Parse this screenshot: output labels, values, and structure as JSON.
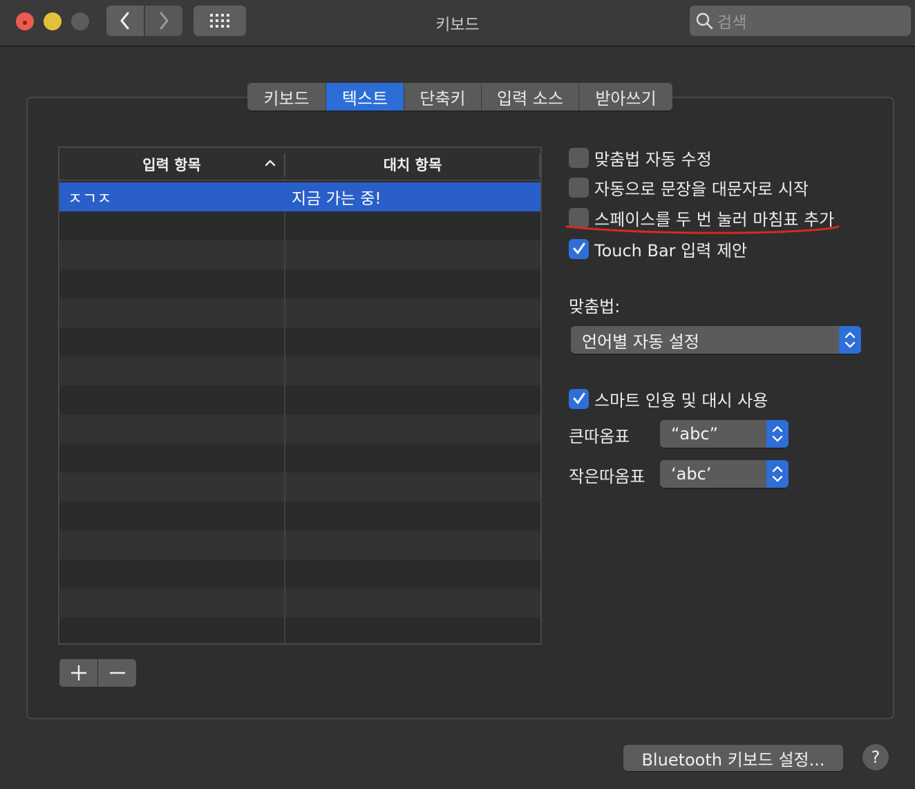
{
  "window": {
    "title": "키보드"
  },
  "search": {
    "placeholder": "검색"
  },
  "tabs": [
    {
      "label": "키보드",
      "active": false
    },
    {
      "label": "텍스트",
      "active": true
    },
    {
      "label": "단축키",
      "active": false
    },
    {
      "label": "입력 소스",
      "active": false
    },
    {
      "label": "받아쓰기",
      "active": false
    }
  ],
  "table": {
    "headers": [
      "입력 항목",
      "대치 항목"
    ],
    "rows": [
      {
        "replace": "ㅈㄱㅈ",
        "with": "지금 가는 중!",
        "selected": true
      }
    ]
  },
  "options": {
    "auto_correct": {
      "label": "맞춤법 자동 수정",
      "checked": false
    },
    "auto_capitalize": {
      "label": "자동으로 문장을 대문자로 시작",
      "checked": false
    },
    "double_space_period": {
      "label": "스페이스를 두 번 눌러 마침표 추가",
      "checked": false
    },
    "touch_bar": {
      "label": "Touch Bar 입력 제안",
      "checked": true
    }
  },
  "spelling": {
    "label": "맞춤법:",
    "value": "언어별 자동 설정"
  },
  "smart_quotes": {
    "label": "스마트 인용 및 대시 사용",
    "checked": true,
    "double_label": "큰따옴표",
    "double_value": "“abc”",
    "single_label": "작은따옴표",
    "single_value": "‘abc’"
  },
  "footer": {
    "bluetooth_button": "Bluetooth 키보드 설정...",
    "help": "?"
  },
  "colors": {
    "accent": "#2d6ed9",
    "selection": "#2a5fc9",
    "annotation": "#d82a1e"
  }
}
